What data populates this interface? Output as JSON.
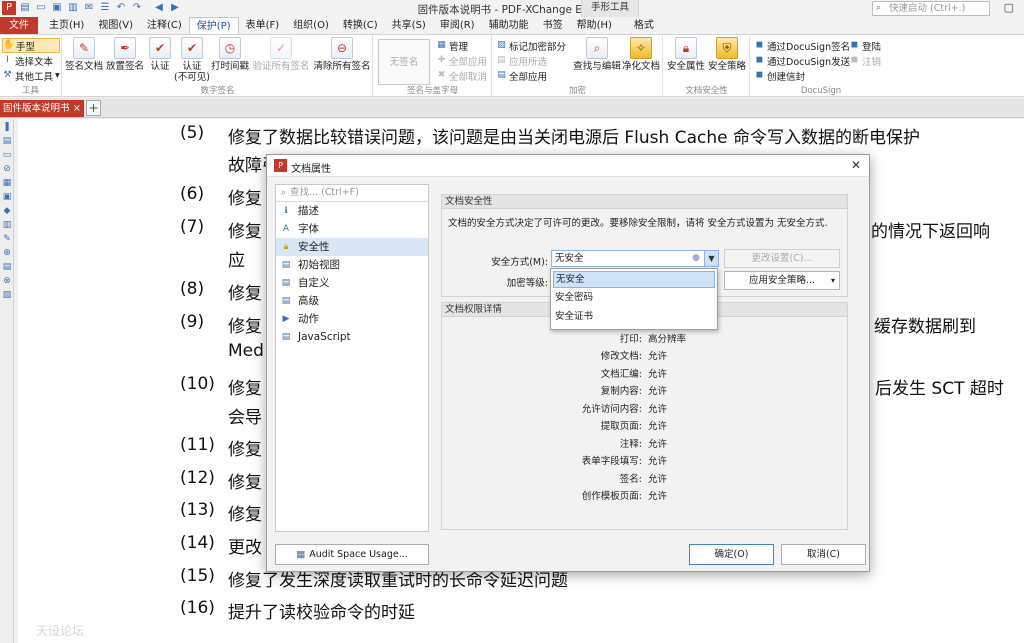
{
  "window": {
    "title": "固件版本说明书 - PDF-XChange Editor",
    "context_group": "手形工具",
    "quick_launch_placeholder": "快速启动 (Ctrl+.)"
  },
  "tabs": [
    "文件",
    "主页(H)",
    "视图(V)",
    "注释(C)",
    "保护(P)",
    "表单(F)",
    "组织(O)",
    "转换(C)",
    "共享(S)",
    "审阅(R)",
    "辅助功能",
    "书签",
    "帮助(H)",
    "格式"
  ],
  "active_tab": "保护(P)",
  "ribbon": {
    "tools_group": {
      "label": "工具",
      "items": [
        "手型",
        "选择文本",
        "其他工具"
      ]
    },
    "digital_sign_group": {
      "label": "数字签名",
      "buttons": [
        "签名文档",
        "放置签名",
        "认证",
        "认证\n(不可见)",
        "打时间戳",
        "验证所有签名",
        "清除所有签名"
      ]
    },
    "sign_stamp_group": {
      "label": "签名与盖字母",
      "unsigned": "无签名",
      "items": [
        "管理",
        "全部应用",
        "全部取消"
      ]
    },
    "encrypt_group": {
      "label": "加密",
      "items": [
        "标记加密部分",
        "应用所选",
        "全部应用"
      ],
      "buttons": [
        "查找与编辑",
        "净化文档"
      ]
    },
    "doc_security_group": {
      "label": "文档安全性",
      "buttons": [
        "安全属性",
        "安全策略"
      ]
    },
    "docusign_group": {
      "label": "DocuSign",
      "items": [
        "通过DocuSign签名",
        "通过DocuSign发送",
        "创建信封",
        "登陆",
        "注销"
      ]
    }
  },
  "document_tab": {
    "name": "固件版本说明书"
  },
  "document": {
    "lines": [
      {
        "num": "(5)",
        "text": "修复了数据比较错误问题，该问题是由当关闭电源后 Flush Cache 命令写入数据的断电保护"
      },
      {
        "num": "",
        "text": "故障引起的"
      },
      {
        "num": "(6)",
        "text": "修复"
      },
      {
        "num": "(7)",
        "text": "修复",
        "tail": "的情况下返回响"
      },
      {
        "num": "",
        "text": "应"
      },
      {
        "num": "(8)",
        "text": "修复"
      },
      {
        "num": "(9)",
        "text": "修复",
        "tail": "缓存数据刷到"
      },
      {
        "num": "",
        "text": "Med"
      },
      {
        "num": "(10)",
        "text": "修复",
        "tail": "后发生 SCT 超时"
      },
      {
        "num": "",
        "text": "会导"
      },
      {
        "num": "(11)",
        "text": "修复"
      },
      {
        "num": "(12)",
        "text": "修复"
      },
      {
        "num": "(13)",
        "text": "修复"
      },
      {
        "num": "(14)",
        "text": "更改"
      },
      {
        "num": "(15)",
        "text": "修复了发生深度读取重试时的长命令延迟问题"
      },
      {
        "num": "(16)",
        "text": "提升了读校验命令的时延"
      }
    ],
    "watermark": "天设论坛"
  },
  "dialog": {
    "title": "文档属性",
    "search_placeholder": "查找... (Ctrl+F)",
    "nav_items": [
      "描述",
      "字体",
      "安全性",
      "初始视图",
      "自定义",
      "高级",
      "动作",
      "JavaScript"
    ],
    "selected_nav": "安全性",
    "security_section": {
      "header": "文档安全性",
      "note": "文档的安全方式决定了可许可的更改。要移除安全限制，请将 安全方式设置为 无安全方式.",
      "method_label": "安全方式(M):",
      "method_value": "无安全",
      "change_settings_button": "更改设置(C)...",
      "encryption_label": "加密等级:",
      "apply_policy_button": "应用安全策略...",
      "dropdown_options": [
        "无安全",
        "安全密码",
        "安全证书"
      ]
    },
    "permissions_section": {
      "header": "文档权限详情",
      "rows": [
        {
          "key": "打印:",
          "value": "高分辨率"
        },
        {
          "key": "修改文档:",
          "value": "允许"
        },
        {
          "key": "文档汇编:",
          "value": "允许"
        },
        {
          "key": "复制内容:",
          "value": "允许"
        },
        {
          "key": "允许访问内容:",
          "value": "允许"
        },
        {
          "key": "提取页面:",
          "value": "允许"
        },
        {
          "key": "注释:",
          "value": "允许"
        },
        {
          "key": "表单字段填写:",
          "value": "允许"
        },
        {
          "key": "签名:",
          "value": "允许"
        },
        {
          "key": "创作模板页面:",
          "value": "允许"
        }
      ]
    },
    "audit_button": "Audit Space Usage...",
    "ok_button": "确定(O)",
    "cancel_button": "取消(C)"
  }
}
